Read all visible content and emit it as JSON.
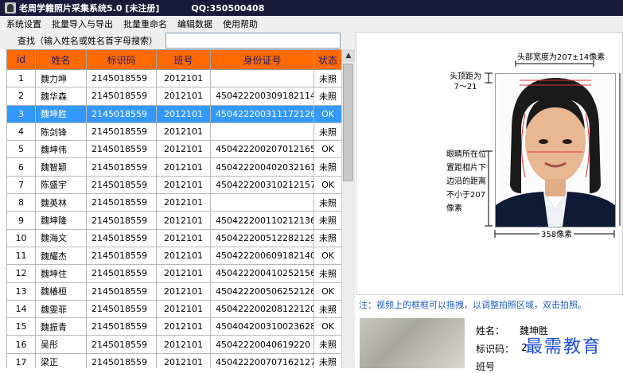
{
  "window": {
    "title": "老周学籍照片采集系统5.0 [未注册]",
    "qq": "QQ:350500408"
  },
  "menu": [
    "系统设置",
    "批量导入与导出",
    "批量重命名",
    "编辑数据",
    "使用帮助"
  ],
  "search": {
    "label": "查找（输入姓名或姓名首字母搜索）",
    "value": ""
  },
  "table": {
    "headers": [
      "id",
      "姓名",
      "标识码",
      "班号",
      "身份证号",
      "状态"
    ],
    "rows": [
      [
        "1",
        "魏力坤",
        "2145018559",
        "2012101",
        "",
        "未照"
      ],
      [
        "2",
        "魏华森",
        "2145018559",
        "2012101",
        "450422200309182114",
        "未照"
      ],
      [
        "3",
        "魏坤胜",
        "2145018559",
        "2012101",
        "450422200311172126",
        "OK"
      ],
      [
        "4",
        "陈剑锋",
        "2145018559",
        "2012101",
        "",
        "未照"
      ],
      [
        "5",
        "魏坤伟",
        "2145018559",
        "2012101",
        "450422200207012165",
        "OK"
      ],
      [
        "6",
        "魏智颖",
        "2145018559",
        "2012101",
        "450422200402032161",
        "未照"
      ],
      [
        "7",
        "陈盛宇",
        "2145018559",
        "2012101",
        "450422200310212157",
        "OK"
      ],
      [
        "8",
        "魏英林",
        "2145018559",
        "2012101",
        "",
        "未照"
      ],
      [
        "9",
        "魏坤隆",
        "2145018559",
        "2012101",
        "450422200110212136",
        "未照"
      ],
      [
        "10",
        "魏海文",
        "2145018559",
        "2012101",
        "450422200512282129",
        "未照"
      ],
      [
        "11",
        "魏耀杰",
        "2145018559",
        "2012101",
        "450422200609182140",
        "OK"
      ],
      [
        "12",
        "魏坤住",
        "2145018559",
        "2012101",
        "450422200410252156",
        "未照"
      ],
      [
        "13",
        "魏椿桓",
        "2145018559",
        "2012101",
        "450422200506252126",
        "OK"
      ],
      [
        "14",
        "魏雯菲",
        "2145018559",
        "2012101",
        "450422200208122120",
        "未照"
      ],
      [
        "15",
        "魏振青",
        "2145018559",
        "2012101",
        "450404200310023628",
        "OK"
      ],
      [
        "16",
        "吴彤",
        "2145018559",
        "2012101",
        "45042220040619220",
        "未照"
      ],
      [
        "17",
        "梁正",
        "2145018559",
        "2012101",
        "450422200707162127",
        "未照"
      ]
    ],
    "selected_index": 2
  },
  "diagram": {
    "head_width": "头部宽度为207±14像素",
    "top_distance": "头顶距为\n7～21",
    "eye_note": "眼睛所在位\n置距相片下\n边沿的距离\n不小于207\n像素",
    "photo_width": "358像素"
  },
  "note": "注：视频上的框框可以拖拽，以调整拍照区域，双击拍照。",
  "info": {
    "name_label": "姓名：",
    "name_value": "魏坤胜",
    "id_label": "标识码：",
    "id_value": "2",
    "next_label": "班号"
  },
  "watermark": "最需教育",
  "colors": {
    "header_bg": "#ff6a00",
    "selected_row": "#3399ff",
    "titlebar": "#1a1a3a",
    "note": "#1e5ec8"
  }
}
